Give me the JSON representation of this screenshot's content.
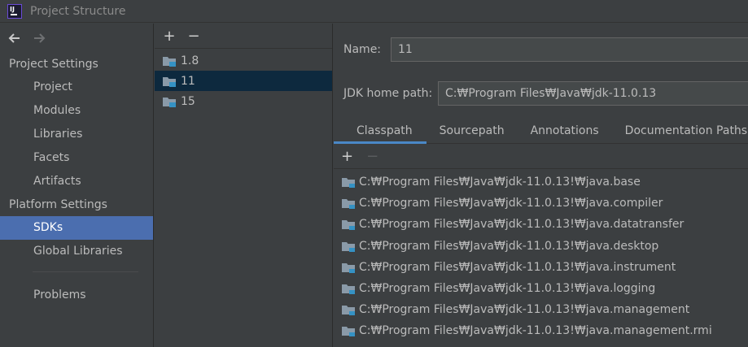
{
  "window": {
    "title": "Project Structure"
  },
  "nav": {
    "project_settings": {
      "label": "Project Settings",
      "items": [
        {
          "label": "Project"
        },
        {
          "label": "Modules"
        },
        {
          "label": "Libraries"
        },
        {
          "label": "Facets"
        },
        {
          "label": "Artifacts"
        }
      ]
    },
    "platform_settings": {
      "label": "Platform Settings",
      "items": [
        {
          "label": "SDKs",
          "selected": true
        },
        {
          "label": "Global Libraries"
        }
      ]
    },
    "problems": {
      "label": "Problems"
    }
  },
  "sdk_list": {
    "add_label": "+",
    "remove_label": "−",
    "items": [
      {
        "label": "1.8"
      },
      {
        "label": "11",
        "selected": true
      },
      {
        "label": "15"
      }
    ]
  },
  "detail": {
    "name_label": "Name:",
    "name_value": "11",
    "home_label": "JDK home path:",
    "home_value": "C:₩Program Files₩Java₩jdk-11.0.13",
    "tabs": [
      {
        "label": "Classpath",
        "active": true
      },
      {
        "label": "Sourcepath"
      },
      {
        "label": "Annotations"
      },
      {
        "label": "Documentation Paths"
      }
    ],
    "classpath_toolbar": {
      "add_label": "+",
      "remove_label": "−"
    },
    "classpath": [
      "C:₩Program Files₩Java₩jdk-11.0.13!₩java.base",
      "C:₩Program Files₩Java₩jdk-11.0.13!₩java.compiler",
      "C:₩Program Files₩Java₩jdk-11.0.13!₩java.datatransfer",
      "C:₩Program Files₩Java₩jdk-11.0.13!₩java.desktop",
      "C:₩Program Files₩Java₩jdk-11.0.13!₩java.instrument",
      "C:₩Program Files₩Java₩jdk-11.0.13!₩java.logging",
      "C:₩Program Files₩Java₩jdk-11.0.13!₩java.management",
      "C:₩Program Files₩Java₩jdk-11.0.13!₩java.management.rmi"
    ]
  },
  "colors": {
    "background": "#3c3f41",
    "selection": "#4b6eaf",
    "list_selection": "#0d293e",
    "tab_underline": "#4a88c7",
    "text": "#bbbbbb"
  }
}
